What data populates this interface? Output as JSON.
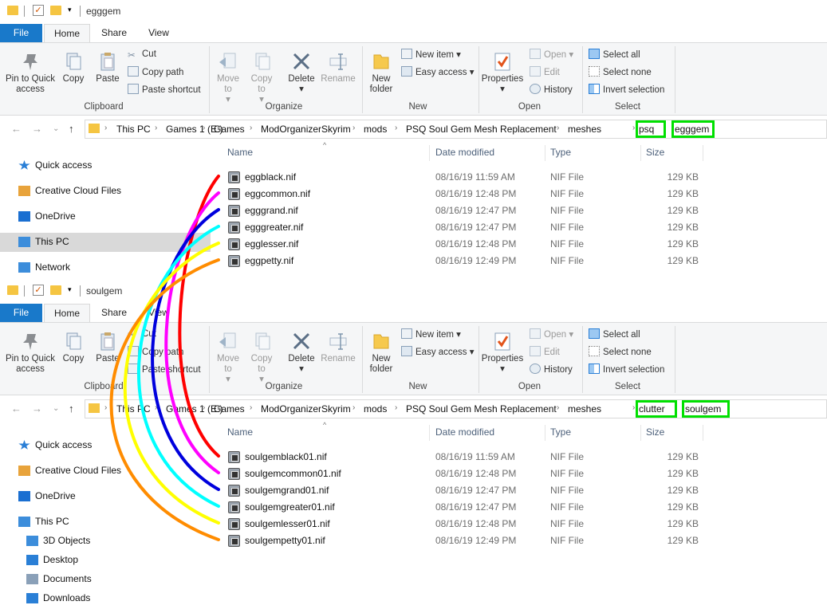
{
  "windows": [
    {
      "title": "egggem",
      "tabs": {
        "file": "File",
        "home": "Home",
        "share": "Share",
        "view": "View"
      },
      "ribbon": {
        "pin": "Pin to Quick access",
        "copy": "Copy",
        "paste": "Paste",
        "cut": "Cut",
        "copy_path": "Copy path",
        "paste_shortcut": "Paste shortcut",
        "move_to": "Move to",
        "copy_to": "Copy to",
        "delete": "Delete",
        "rename": "Rename",
        "new_folder": "New folder",
        "new_item": "New item",
        "easy_access": "Easy access",
        "properties": "Properties",
        "open": "Open",
        "edit": "Edit",
        "history": "History",
        "select_all": "Select all",
        "select_none": "Select none",
        "invert_selection": "Invert selection",
        "groups": {
          "clipboard": "Clipboard",
          "organize": "Organize",
          "new": "New",
          "open": "Open",
          "select": "Select"
        }
      },
      "breadcrumb": [
        "This PC",
        "Games 1 (E:)",
        "Games",
        "ModOrganizerSkyrim",
        "mods",
        "PSQ Soul Gem Mesh Replacement",
        "meshes",
        "psq",
        "egggem"
      ],
      "nav": [
        "Quick access",
        "Creative Cloud Files",
        "OneDrive",
        "This PC",
        "Network"
      ],
      "columns": {
        "name": "Name",
        "date": "Date modified",
        "type": "Type",
        "size": "Size"
      },
      "files": [
        {
          "name": "eggblack.nif",
          "date": "08/16/19 11:59 AM",
          "type": "NIF File",
          "size": "129 KB"
        },
        {
          "name": "eggcommon.nif",
          "date": "08/16/19 12:48 PM",
          "type": "NIF File",
          "size": "129 KB"
        },
        {
          "name": "egggrand.nif",
          "date": "08/16/19 12:47 PM",
          "type": "NIF File",
          "size": "129 KB"
        },
        {
          "name": "egggreater.nif",
          "date": "08/16/19 12:47 PM",
          "type": "NIF File",
          "size": "129 KB"
        },
        {
          "name": "egglesser.nif",
          "date": "08/16/19 12:48 PM",
          "type": "NIF File",
          "size": "129 KB"
        },
        {
          "name": "eggpetty.nif",
          "date": "08/16/19 12:49 PM",
          "type": "NIF File",
          "size": "129 KB"
        }
      ]
    },
    {
      "title": "soulgem",
      "tabs": {
        "file": "File",
        "home": "Home",
        "share": "Share",
        "view": "View"
      },
      "ribbon": {
        "pin": "Pin to Quick access",
        "copy": "Copy",
        "paste": "Paste",
        "cut": "Cut",
        "copy_path": "Copy path",
        "paste_shortcut": "Paste shortcut",
        "move_to": "Move to",
        "copy_to": "Copy to",
        "delete": "Delete",
        "rename": "Rename",
        "new_folder": "New folder",
        "new_item": "New item",
        "easy_access": "Easy access",
        "properties": "Properties",
        "open": "Open",
        "edit": "Edit",
        "history": "History",
        "select_all": "Select all",
        "select_none": "Select none",
        "invert_selection": "Invert selection",
        "groups": {
          "clipboard": "Clipboard",
          "organize": "Organize",
          "new": "New",
          "open": "Open",
          "select": "Select"
        }
      },
      "breadcrumb": [
        "This PC",
        "Games 1 (E:)",
        "Games",
        "ModOrganizerSkyrim",
        "mods",
        "PSQ Soul Gem Mesh Replacement",
        "meshes",
        "clutter",
        "soulgem"
      ],
      "nav": [
        "Quick access",
        "Creative Cloud Files",
        "OneDrive",
        "This PC",
        "3D Objects",
        "Desktop",
        "Documents",
        "Downloads"
      ],
      "columns": {
        "name": "Name",
        "date": "Date modified",
        "type": "Type",
        "size": "Size"
      },
      "files": [
        {
          "name": "soulgemblack01.nif",
          "date": "08/16/19 11:59 AM",
          "type": "NIF File",
          "size": "129 KB"
        },
        {
          "name": "soulgemcommon01.nif",
          "date": "08/16/19 12:48 PM",
          "type": "NIF File",
          "size": "129 KB"
        },
        {
          "name": "soulgemgrand01.nif",
          "date": "08/16/19 12:47 PM",
          "type": "NIF File",
          "size": "129 KB"
        },
        {
          "name": "soulgemgreater01.nif",
          "date": "08/16/19 12:47 PM",
          "type": "NIF File",
          "size": "129 KB"
        },
        {
          "name": "soulgemlesser01.nif",
          "date": "08/16/19 12:48 PM",
          "type": "NIF File",
          "size": "129 KB"
        },
        {
          "name": "soulgempetty01.nif",
          "date": "08/16/19 12:49 PM",
          "type": "NIF File",
          "size": "129 KB"
        }
      ]
    }
  ],
  "colors": {
    "highlight": "#00e000",
    "file_tab": "#1979ca",
    "arc_colors": [
      "#ff0000",
      "#ff00ff",
      "#0000dd",
      "#00ffff",
      "#ffff00",
      "#ff8c00"
    ]
  }
}
